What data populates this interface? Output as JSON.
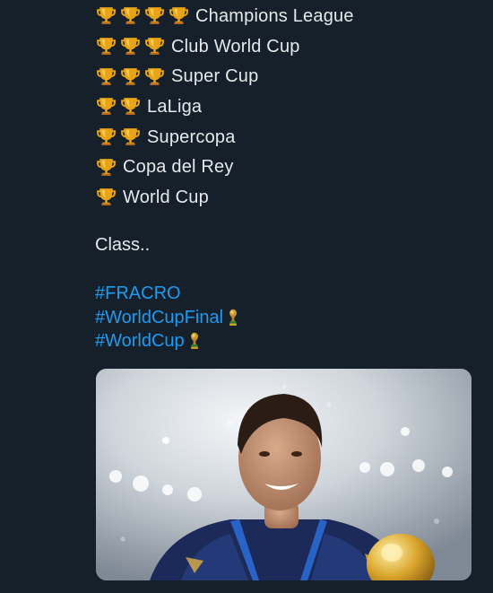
{
  "tweet": {
    "trophy_lines": [
      {
        "count": 4,
        "label": "Champions League"
      },
      {
        "count": 3,
        "label": "Club World Cup"
      },
      {
        "count": 3,
        "label": "Super Cup"
      },
      {
        "count": 2,
        "label": "LaLiga"
      },
      {
        "count": 2,
        "label": "Supercopa"
      },
      {
        "count": 1,
        "label": "Copa del Rey"
      },
      {
        "count": 1,
        "label": "World Cup"
      }
    ],
    "trophy_icon": "trophy-emoji",
    "closing_text": "Class..",
    "hashtags": [
      {
        "text": "#FRACRO",
        "emoji": null
      },
      {
        "text": "#WorldCupFinal",
        "emoji": "world-cup-trophy-emoji"
      },
      {
        "text": "#WorldCup",
        "emoji": "world-cup-trophy-emoji"
      }
    ]
  },
  "media": {
    "kind": "photo",
    "subject": "football-player-with-world-cup-trophy"
  },
  "colors": {
    "background": "#15202b",
    "text": "#e6e9eb",
    "hashtag": "#1d9bf0",
    "trophy_gold": "#e8a317"
  }
}
